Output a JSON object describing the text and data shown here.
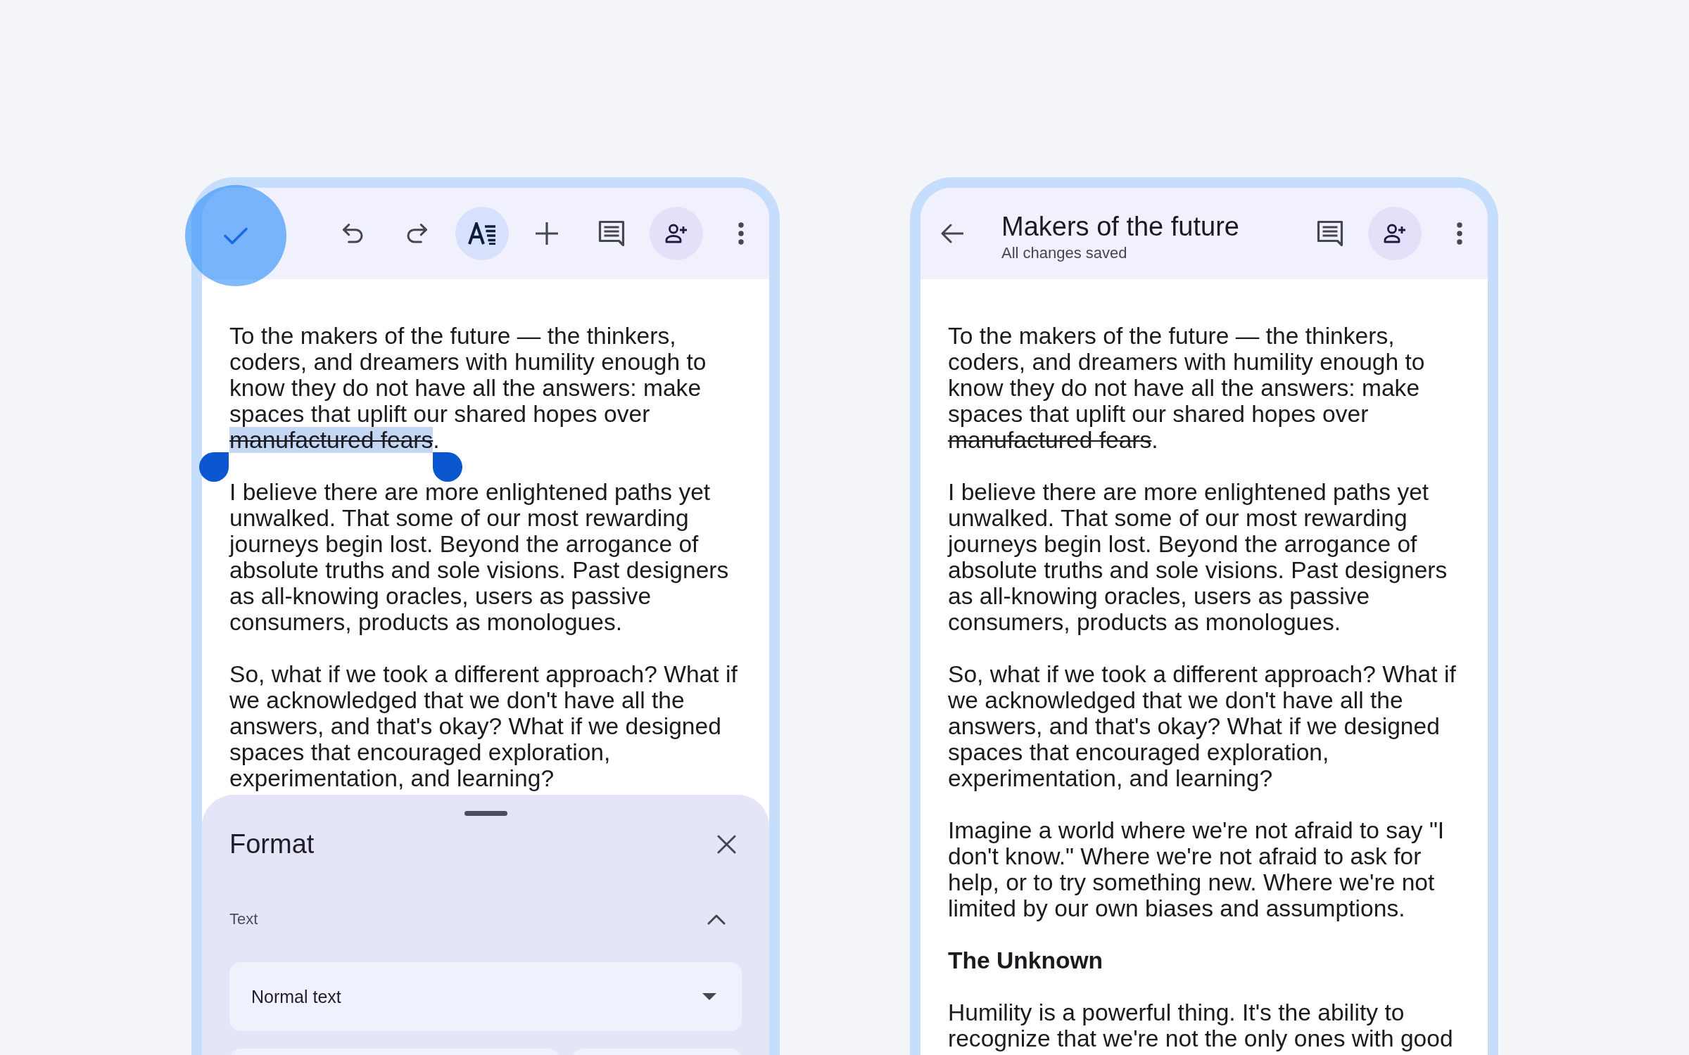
{
  "screens": [
    {
      "toolbar": {
        "leading": {
          "kind": "check"
        },
        "actions": [
          {
            "kind": "undo",
            "selected": false
          },
          {
            "kind": "redo",
            "selected": false
          },
          {
            "kind": "text_format",
            "selected": true
          },
          {
            "kind": "insert",
            "selected": false
          },
          {
            "kind": "comment",
            "selected": false
          },
          {
            "kind": "share",
            "selected": false
          },
          {
            "kind": "more",
            "selected": false
          }
        ]
      },
      "paragraphs": [
        {
          "kind": "body",
          "runs": [
            {
              "text": "To the makers of the future — the thinkers,\ncoders, and dreamers with humility enough to\nknow they do not have all the answers: make\nspaces that uplift our shared hopes over\n",
              "strike": false,
              "selected": false
            },
            {
              "text": "manufactured fears",
              "strike": true,
              "selected": true
            },
            {
              "text": ".",
              "strike": false,
              "selected": false
            }
          ]
        },
        {
          "kind": "body",
          "runs": [
            {
              "text": "I believe there are more enlightened paths yet\nunwalked. That some of our most rewarding\njourneys begin lost. Beyond the arrogance of\nabsolute truths and sole visions. Past designers\nas all-knowing oracles, users as passive\nconsumers, products as monologues.",
              "strike": false,
              "selected": false
            }
          ]
        },
        {
          "kind": "body",
          "runs": [
            {
              "text": "So, what if we took a different approach? What if\nwe acknowledged that we don't have all the\nanswers, and that's okay? What if we designed\nspaces that encouraged exploration,\nexperimentation, and learning?",
              "strike": false,
              "selected": false
            }
          ]
        }
      ],
      "sheet": {
        "title": "Format",
        "sections": [
          {
            "label": "Text",
            "expanded": true,
            "style": {
              "value": "Normal text"
            }
          }
        ]
      }
    },
    {
      "toolbar": {
        "leading": {
          "kind": "back"
        },
        "title": "Makers of the future",
        "subtitle": "All changes saved",
        "actions": [
          {
            "kind": "comment",
            "selected": false
          },
          {
            "kind": "share",
            "selected": false
          },
          {
            "kind": "more",
            "selected": false
          }
        ]
      },
      "paragraphs": [
        {
          "kind": "body",
          "runs": [
            {
              "text": "To the makers of the future — the thinkers,\ncoders, and dreamers with humility enough to\nknow they do not have all the answers: make\nspaces that uplift our shared hopes over\n",
              "strike": false,
              "selected": false
            },
            {
              "text": "manufactured fears",
              "strike": true,
              "selected": false
            },
            {
              "text": ".",
              "strike": false,
              "selected": false
            }
          ]
        },
        {
          "kind": "body",
          "runs": [
            {
              "text": "I believe there are more enlightened paths yet\nunwalked. That some of our most rewarding\njourneys begin lost. Beyond the arrogance of\nabsolute truths and sole visions. Past designers\nas all-knowing oracles, users as passive\nconsumers, products as monologues.",
              "strike": false,
              "selected": false
            }
          ]
        },
        {
          "kind": "body",
          "runs": [
            {
              "text": "So, what if we took a different approach? What if\nwe acknowledged that we don't have all the\nanswers, and that's okay? What if we designed\nspaces that encouraged exploration,\nexperimentation, and learning?",
              "strike": false,
              "selected": false
            }
          ]
        },
        {
          "kind": "body",
          "runs": [
            {
              "text": "Imagine a world where we're not afraid to say \"I\ndon't know.\" Where we're not afraid to ask for\nhelp, or to try something new. Where we're not\nlimited by our own biases and assumptions.",
              "strike": false,
              "selected": false
            }
          ]
        },
        {
          "kind": "heading",
          "runs": [
            {
              "text": "The Unknown",
              "strike": false,
              "selected": false
            }
          ]
        },
        {
          "kind": "body",
          "runs": [
            {
              "text": "Humility is a powerful thing. It's the ability to\nrecognize that we're not the only ones with good",
              "strike": false,
              "selected": false
            }
          ]
        }
      ]
    }
  ]
}
